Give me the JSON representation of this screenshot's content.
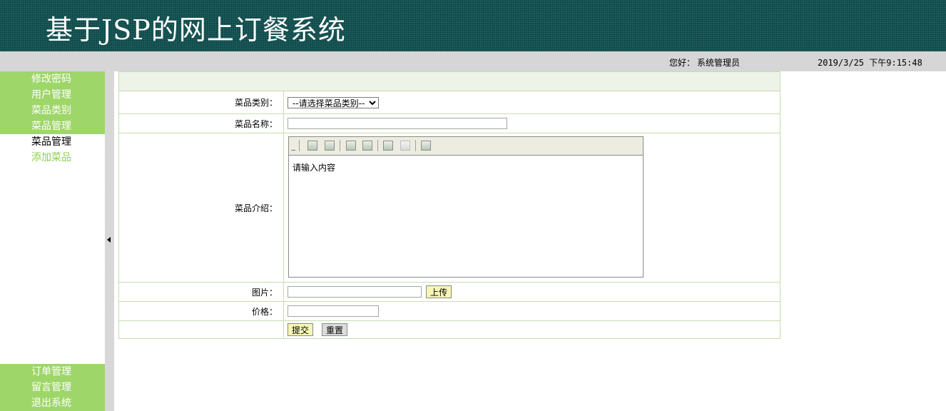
{
  "app": {
    "title": "基于JSP的网上订餐系统"
  },
  "status": {
    "greeting": "您好：",
    "user": "系统管理员",
    "datetime": "2019/3/25 下午9:15:48"
  },
  "sidebar": {
    "top_items": [
      {
        "label": "修改密码"
      },
      {
        "label": "用户管理"
      },
      {
        "label": "菜品类别"
      },
      {
        "label": "菜品管理"
      }
    ],
    "active_item": {
      "label": "菜品管理"
    },
    "sub_item": {
      "label": "添加菜品"
    },
    "bottom_items": [
      {
        "label": "订单管理"
      },
      {
        "label": "留言管理"
      },
      {
        "label": "退出系统"
      }
    ],
    "accent_color": "#9fd66a"
  },
  "form": {
    "category_label": "菜品类别：",
    "category_selected": "--请选择菜品类别--",
    "name_label": "菜品名称：",
    "name_value": "",
    "intro_label": "菜品介绍：",
    "intro_placeholder": "请输入内容",
    "image_label": "图片：",
    "image_value": "",
    "upload_button": "上传",
    "price_label": "价格：",
    "price_value": "",
    "submit_button": "提交",
    "reset_button": "重置"
  },
  "editor_toolbar": {
    "icons": [
      "image-icon",
      "image-icon",
      "table-icon",
      "table-icon",
      "copy-icon",
      "paste-icon",
      "insert-icon"
    ]
  },
  "colors": {
    "header_bg": "#0d4a4a",
    "statusbar_bg": "#d6d6d6",
    "submit_bg": "#f6f7b4"
  }
}
